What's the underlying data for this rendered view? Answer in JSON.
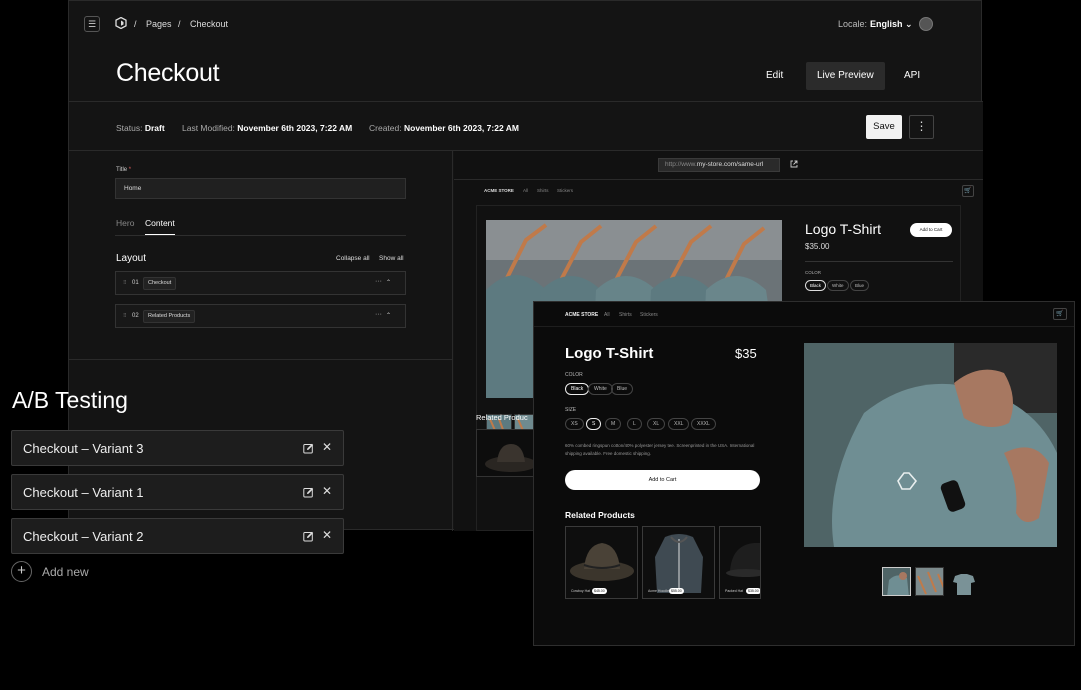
{
  "breadcrumb": {
    "sep1": "/",
    "pages": "Pages",
    "sep2": "/",
    "current": "Checkout"
  },
  "locale": {
    "label": "Locale:",
    "value": "English ⌄"
  },
  "page_title": "Checkout",
  "view_tabs": {
    "edit": "Edit",
    "live_preview": "Live Preview",
    "api": "API"
  },
  "status": {
    "status_label": "Status:",
    "status_value": "Draft",
    "modified_label": "Last Modified:",
    "modified_value": "November 6th 2023, 7:22 AM",
    "created_label": "Created:",
    "created_value": "November 6th 2023, 7:22 AM",
    "save": "Save",
    "more": "⋮"
  },
  "editor": {
    "title_label": "Title",
    "title_required": "*",
    "title_value": "Home",
    "tabs": {
      "hero": "Hero",
      "content": "Content"
    },
    "layout_title": "Layout",
    "collapse_all": "Collapse all",
    "show_all": "Show all",
    "blocks": [
      {
        "num": "01",
        "name": "Checkout",
        "dots": "···",
        "caret": "⌃"
      },
      {
        "num": "02",
        "name": "Related Products",
        "dots": "···",
        "caret": "⌃"
      }
    ]
  },
  "preview": {
    "url_prefix": "http://www.",
    "url_main": "my-store.com/same-url",
    "bg": {
      "nav": {
        "store": "ACME STORE",
        "all": "All",
        "shirts": "Shirts",
        "stickers": "Stickers"
      },
      "product_title": "Logo T-Shirt",
      "price": "$35.00",
      "add_to_cart": "Add to Cart",
      "color_label": "COLOR",
      "colors": [
        "Black",
        "White",
        "Blue"
      ],
      "related": "Related Produc"
    },
    "front": {
      "nav": {
        "store": "ACME STORE",
        "all": "All",
        "shirts": "Shirts",
        "stickers": "Stickers"
      },
      "product_title": "Logo T-Shirt",
      "price": "$35",
      "color_label": "COLOR",
      "colors": [
        "Black",
        "White",
        "Blue"
      ],
      "size_label": "SIZE",
      "sizes": [
        "XS",
        "S",
        "M",
        "L",
        "XL",
        "XXL",
        "XXXL"
      ],
      "description": "60% combed ringspun cotton/40% polyester jersey tee. Screenprinted in the USA. International shipping available. Free domestic shipping.",
      "add_to_cart": "Add to Cart",
      "related_title": "Related Products",
      "related": [
        {
          "name": "Cowboy Hat",
          "price": "$45.00"
        },
        {
          "name": "Acme Hoodie",
          "price": "$55.00"
        },
        {
          "name": "Packed Hat",
          "price": "$35.00"
        }
      ]
    }
  },
  "ab_testing": {
    "title": "A/B Testing",
    "variants": [
      "Checkout – Variant 3",
      "Checkout – Variant 1",
      "Checkout – Variant 2"
    ],
    "add_new": "Add new",
    "close_glyph": "✕",
    "add_glyph": "+"
  },
  "colors": {
    "background": "#000000",
    "panel": "#141414",
    "accent_button": "#f2f2f2"
  }
}
